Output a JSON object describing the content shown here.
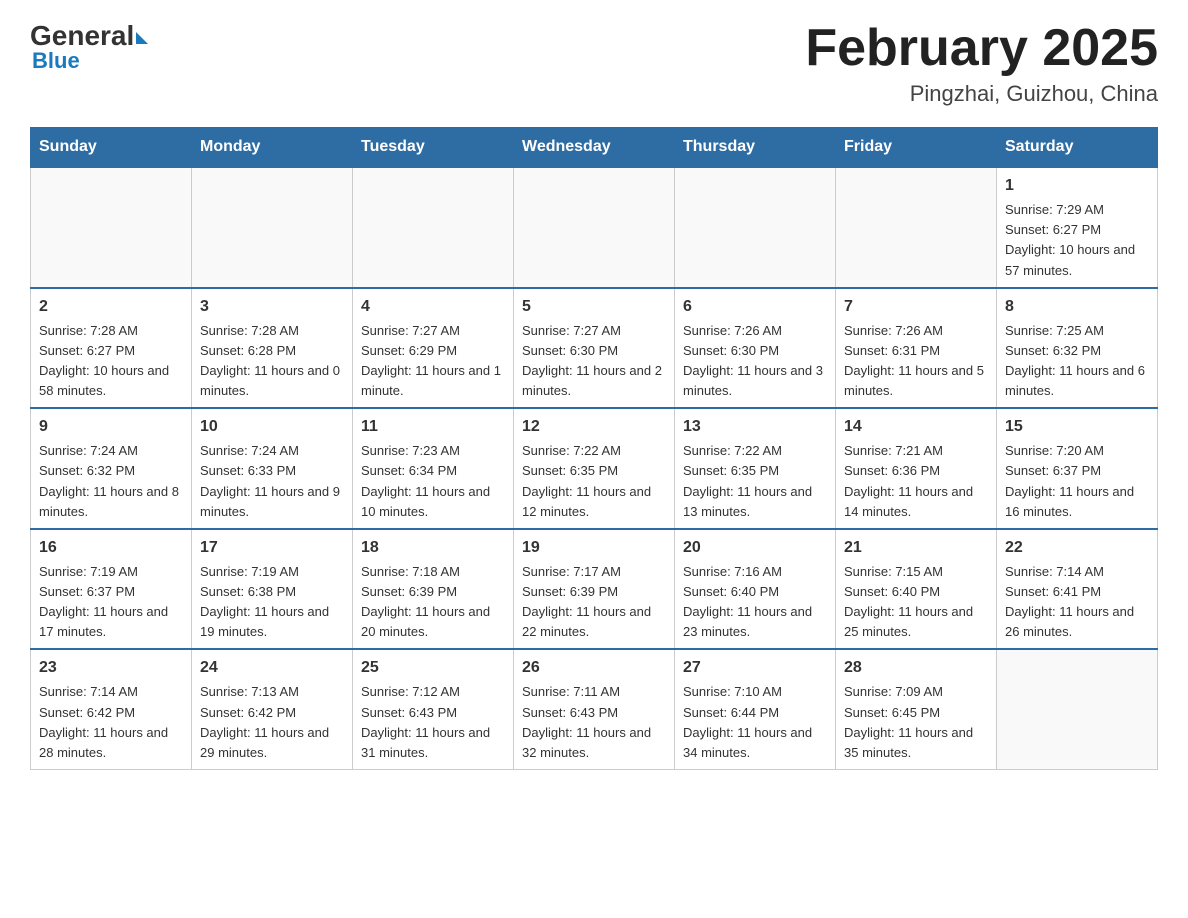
{
  "header": {
    "logo": {
      "general": "General",
      "blue": "Blue",
      "subtitle": "Blue"
    },
    "title": "February 2025",
    "location": "Pingzhai, Guizhou, China"
  },
  "days_of_week": [
    "Sunday",
    "Monday",
    "Tuesday",
    "Wednesday",
    "Thursday",
    "Friday",
    "Saturday"
  ],
  "weeks": [
    {
      "days": [
        {
          "num": "",
          "empty": true
        },
        {
          "num": "",
          "empty": true
        },
        {
          "num": "",
          "empty": true
        },
        {
          "num": "",
          "empty": true
        },
        {
          "num": "",
          "empty": true
        },
        {
          "num": "",
          "empty": true
        },
        {
          "num": "1",
          "sunrise": "7:29 AM",
          "sunset": "6:27 PM",
          "daylight": "10 hours and 57 minutes."
        }
      ]
    },
    {
      "days": [
        {
          "num": "2",
          "sunrise": "7:28 AM",
          "sunset": "6:27 PM",
          "daylight": "10 hours and 58 minutes."
        },
        {
          "num": "3",
          "sunrise": "7:28 AM",
          "sunset": "6:28 PM",
          "daylight": "11 hours and 0 minutes."
        },
        {
          "num": "4",
          "sunrise": "7:27 AM",
          "sunset": "6:29 PM",
          "daylight": "11 hours and 1 minute."
        },
        {
          "num": "5",
          "sunrise": "7:27 AM",
          "sunset": "6:30 PM",
          "daylight": "11 hours and 2 minutes."
        },
        {
          "num": "6",
          "sunrise": "7:26 AM",
          "sunset": "6:30 PM",
          "daylight": "11 hours and 3 minutes."
        },
        {
          "num": "7",
          "sunrise": "7:26 AM",
          "sunset": "6:31 PM",
          "daylight": "11 hours and 5 minutes."
        },
        {
          "num": "8",
          "sunrise": "7:25 AM",
          "sunset": "6:32 PM",
          "daylight": "11 hours and 6 minutes."
        }
      ]
    },
    {
      "days": [
        {
          "num": "9",
          "sunrise": "7:24 AM",
          "sunset": "6:32 PM",
          "daylight": "11 hours and 8 minutes."
        },
        {
          "num": "10",
          "sunrise": "7:24 AM",
          "sunset": "6:33 PM",
          "daylight": "11 hours and 9 minutes."
        },
        {
          "num": "11",
          "sunrise": "7:23 AM",
          "sunset": "6:34 PM",
          "daylight": "11 hours and 10 minutes."
        },
        {
          "num": "12",
          "sunrise": "7:22 AM",
          "sunset": "6:35 PM",
          "daylight": "11 hours and 12 minutes."
        },
        {
          "num": "13",
          "sunrise": "7:22 AM",
          "sunset": "6:35 PM",
          "daylight": "11 hours and 13 minutes."
        },
        {
          "num": "14",
          "sunrise": "7:21 AM",
          "sunset": "6:36 PM",
          "daylight": "11 hours and 14 minutes."
        },
        {
          "num": "15",
          "sunrise": "7:20 AM",
          "sunset": "6:37 PM",
          "daylight": "11 hours and 16 minutes."
        }
      ]
    },
    {
      "days": [
        {
          "num": "16",
          "sunrise": "7:19 AM",
          "sunset": "6:37 PM",
          "daylight": "11 hours and 17 minutes."
        },
        {
          "num": "17",
          "sunrise": "7:19 AM",
          "sunset": "6:38 PM",
          "daylight": "11 hours and 19 minutes."
        },
        {
          "num": "18",
          "sunrise": "7:18 AM",
          "sunset": "6:39 PM",
          "daylight": "11 hours and 20 minutes."
        },
        {
          "num": "19",
          "sunrise": "7:17 AM",
          "sunset": "6:39 PM",
          "daylight": "11 hours and 22 minutes."
        },
        {
          "num": "20",
          "sunrise": "7:16 AM",
          "sunset": "6:40 PM",
          "daylight": "11 hours and 23 minutes."
        },
        {
          "num": "21",
          "sunrise": "7:15 AM",
          "sunset": "6:40 PM",
          "daylight": "11 hours and 25 minutes."
        },
        {
          "num": "22",
          "sunrise": "7:14 AM",
          "sunset": "6:41 PM",
          "daylight": "11 hours and 26 minutes."
        }
      ]
    },
    {
      "days": [
        {
          "num": "23",
          "sunrise": "7:14 AM",
          "sunset": "6:42 PM",
          "daylight": "11 hours and 28 minutes."
        },
        {
          "num": "24",
          "sunrise": "7:13 AM",
          "sunset": "6:42 PM",
          "daylight": "11 hours and 29 minutes."
        },
        {
          "num": "25",
          "sunrise": "7:12 AM",
          "sunset": "6:43 PM",
          "daylight": "11 hours and 31 minutes."
        },
        {
          "num": "26",
          "sunrise": "7:11 AM",
          "sunset": "6:43 PM",
          "daylight": "11 hours and 32 minutes."
        },
        {
          "num": "27",
          "sunrise": "7:10 AM",
          "sunset": "6:44 PM",
          "daylight": "11 hours and 34 minutes."
        },
        {
          "num": "28",
          "sunrise": "7:09 AM",
          "sunset": "6:45 PM",
          "daylight": "11 hours and 35 minutes."
        },
        {
          "num": "",
          "empty": true
        }
      ]
    }
  ]
}
